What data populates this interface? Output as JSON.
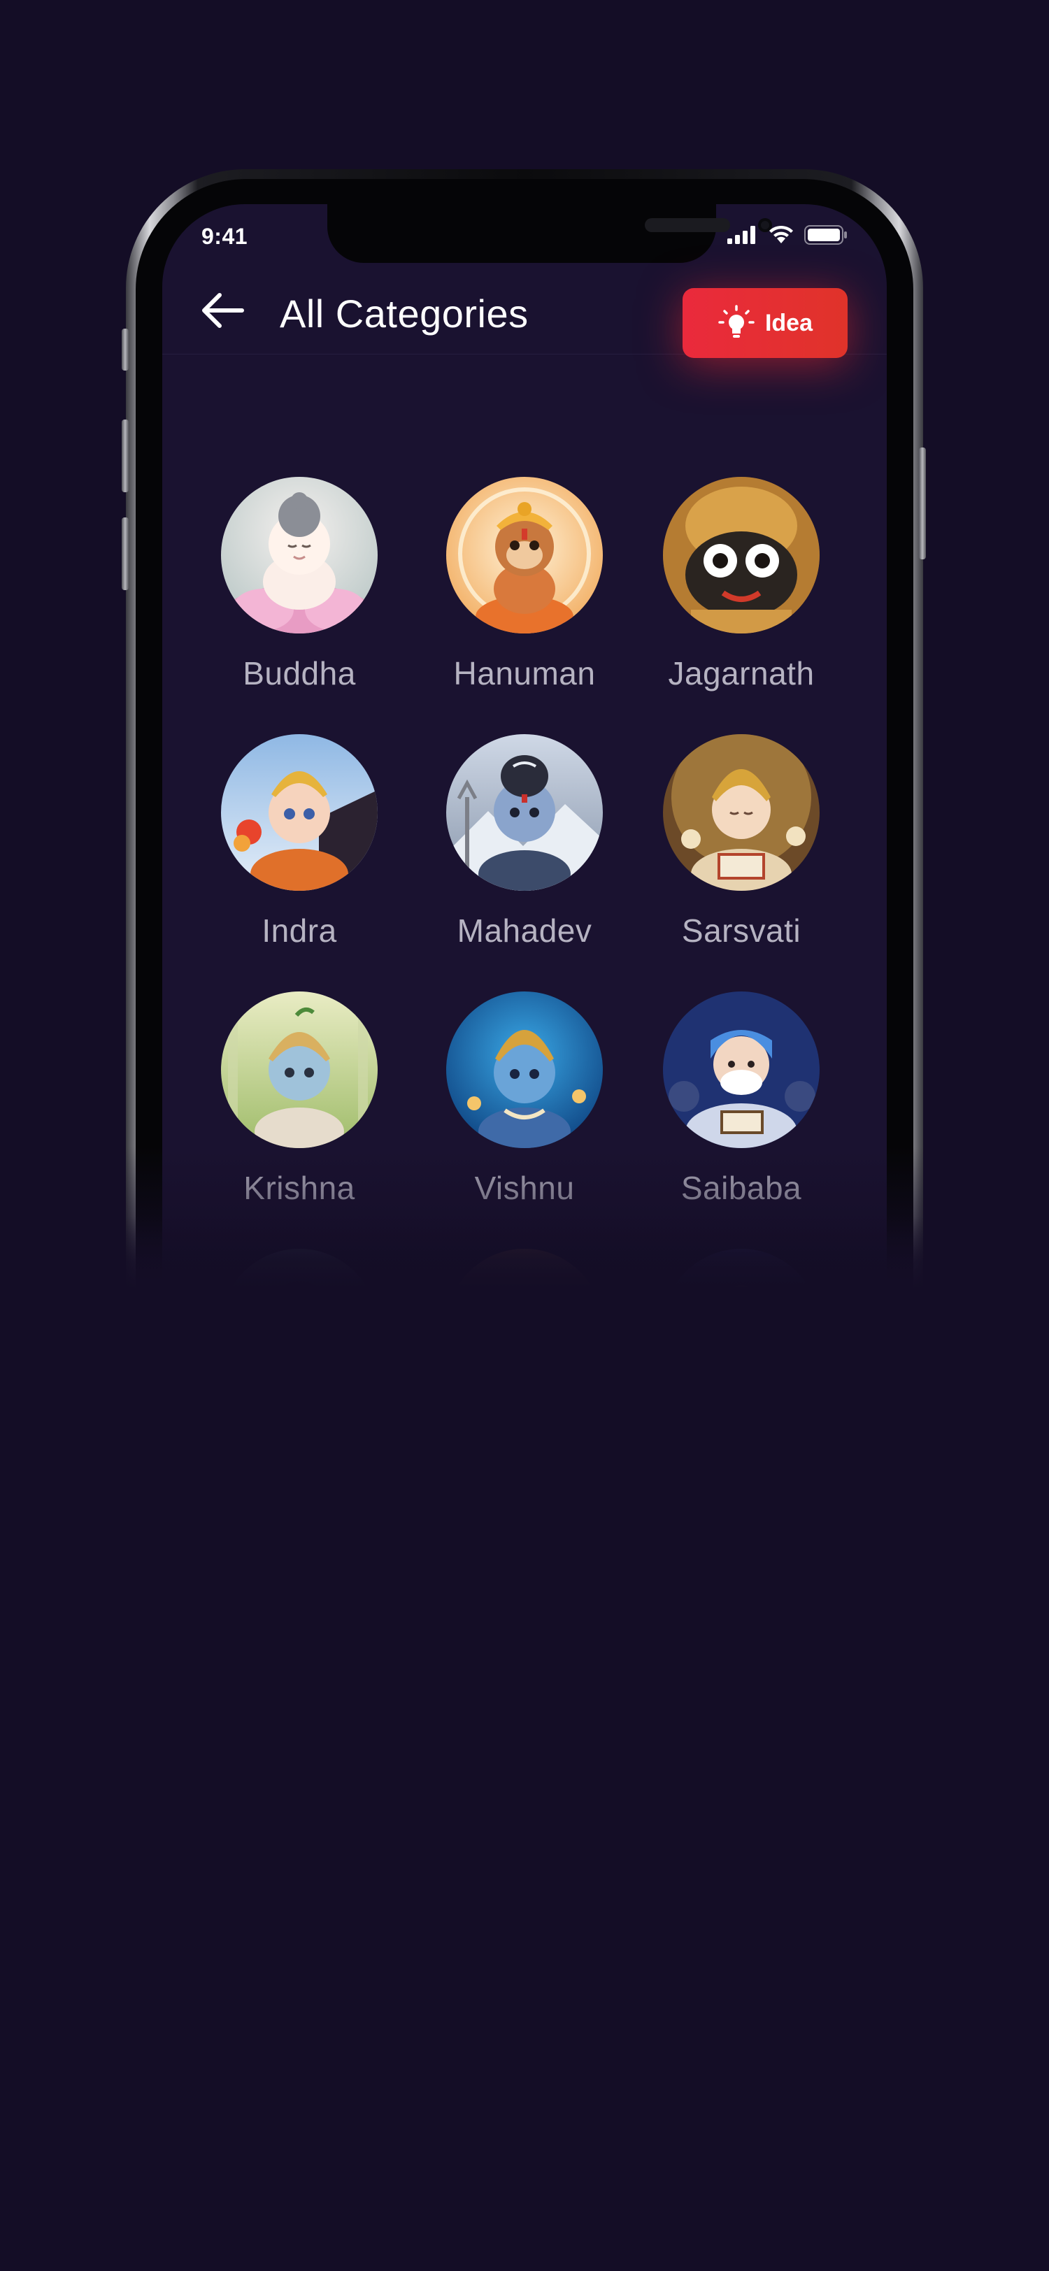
{
  "status_bar": {
    "time": "9:41"
  },
  "header": {
    "title": "All Categories",
    "back_icon": "arrow-left-icon",
    "idea_button": {
      "label": "Idea",
      "icon": "lightbulb-icon",
      "color": "#e8283a"
    }
  },
  "categories": [
    {
      "label": "Buddha"
    },
    {
      "label": "Hanuman"
    },
    {
      "label": "Jagarnath"
    },
    {
      "label": "Indra"
    },
    {
      "label": "Mahadev"
    },
    {
      "label": "Sarsvati"
    },
    {
      "label": "Krishna"
    },
    {
      "label": "Vishnu"
    },
    {
      "label": "Saibaba"
    },
    {
      "label": ""
    },
    {
      "label": ""
    },
    {
      "label": ""
    }
  ],
  "colors": {
    "background": "#140d26",
    "screen": "#1a1230",
    "label": "#b6b3c2",
    "accent": "#e8283a"
  }
}
